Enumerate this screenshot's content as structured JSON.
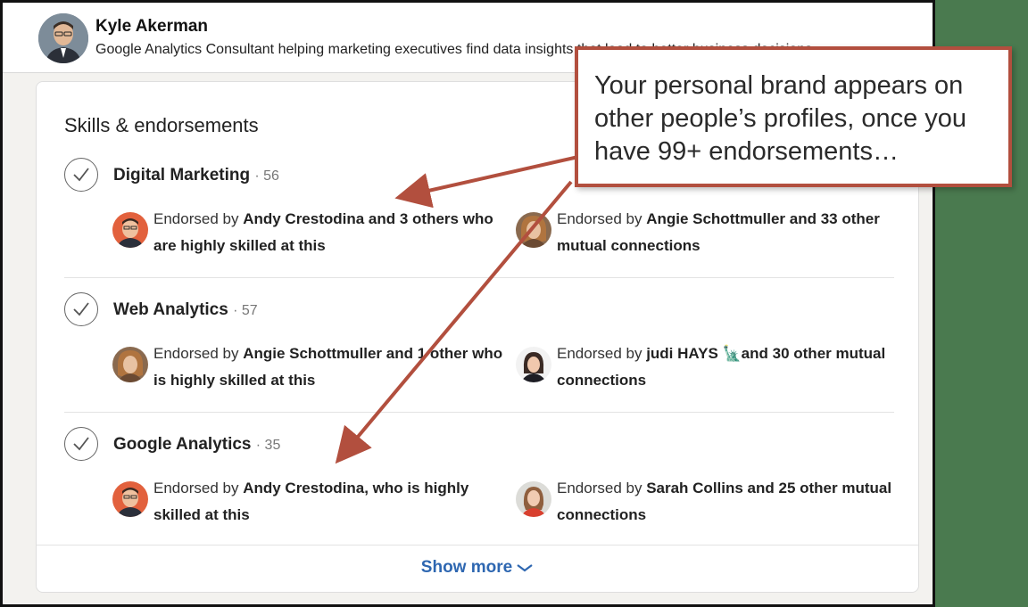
{
  "profile": {
    "name": "Kyle Akerman",
    "headline": "Google Analytics Consultant helping marketing executives find data insights that lead to better business decisions"
  },
  "card": {
    "title": "Skills & endorsements",
    "show_more": "Show more",
    "skills": [
      {
        "name": "Digital Marketing",
        "count": "· 56",
        "endorsements": [
          {
            "prefix": "Endorsed by ",
            "bold": "Andy Crestodina and 3 others who are highly skilled at this",
            "avatar": "andy-avatar"
          },
          {
            "prefix": "Endorsed by ",
            "bold": "Angie Schottmuller and 33 other mutual connections",
            "avatar": "angie-avatar"
          }
        ]
      },
      {
        "name": "Web Analytics",
        "count": "· 57",
        "endorsements": [
          {
            "prefix": "Endorsed by ",
            "bold": "Angie Schottmuller and 1 other who is highly skilled at this",
            "avatar": "angie-avatar"
          },
          {
            "prefix": "Endorsed by ",
            "bold": "judi HAYS 🗽and 30 other mutual connections",
            "avatar": "judi-avatar"
          }
        ]
      },
      {
        "name": "Google Analytics",
        "count": "· 35",
        "endorsements": [
          {
            "prefix": "Endorsed by ",
            "bold": "Andy Crestodina, who is highly skilled at this",
            "avatar": "andy-avatar"
          },
          {
            "prefix": "Endorsed by ",
            "bold": "Sarah Collins and 25 other mutual connections",
            "avatar": "sarah-avatar"
          }
        ]
      }
    ]
  },
  "callout": {
    "text": "Your personal brand appears on other people’s profiles, once you have 99+ endorsements…"
  },
  "colors": {
    "accent_link": "#2e67b1",
    "callout_border": "#b24f3e",
    "background_outside": "#4a7a4f"
  }
}
